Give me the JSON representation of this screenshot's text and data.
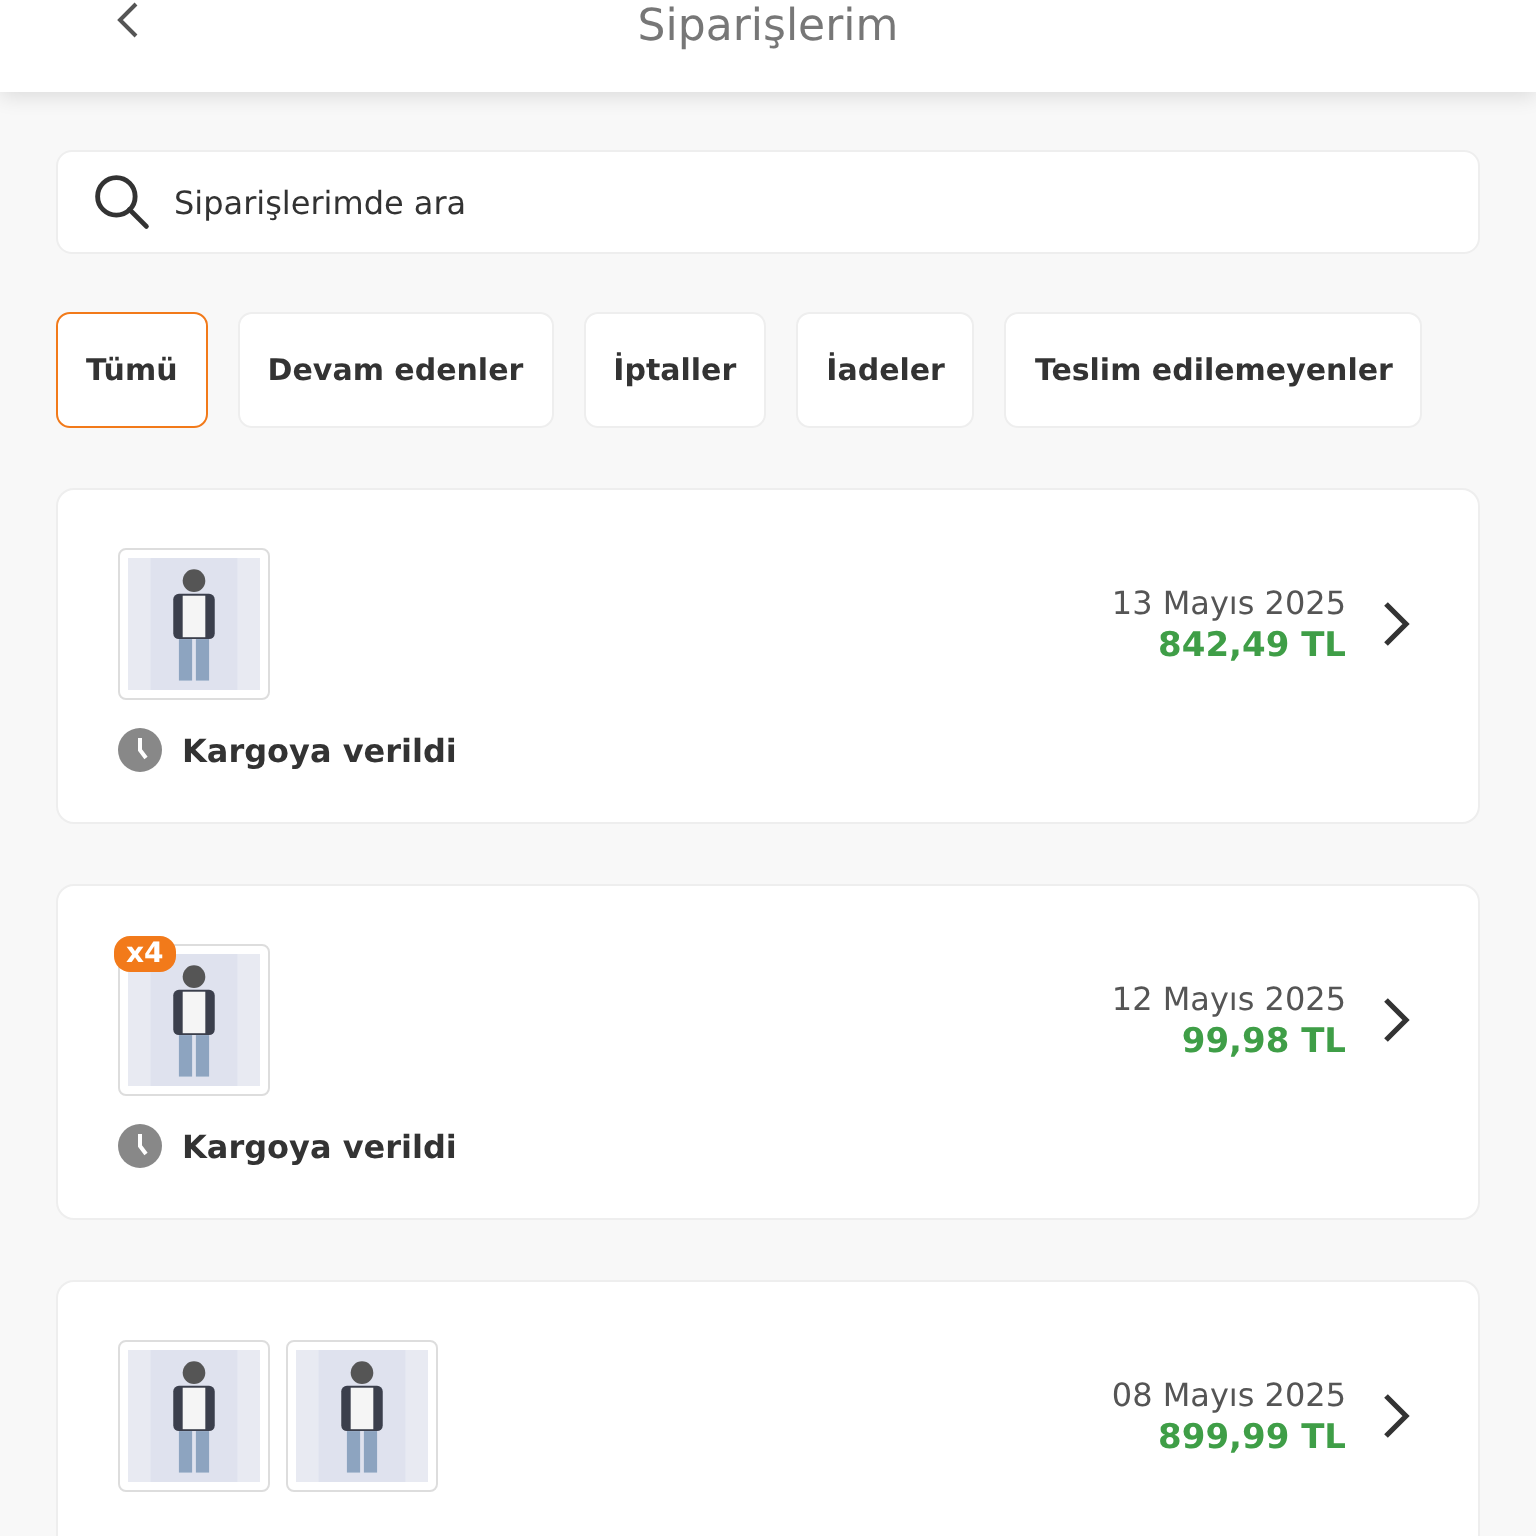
{
  "header": {
    "title": "Siparişlerim"
  },
  "search": {
    "placeholder": "Siparişlerimde ara"
  },
  "filters": [
    {
      "label": "Tümü",
      "selected": true
    },
    {
      "label": "Devam edenler",
      "selected": false
    },
    {
      "label": "İptaller",
      "selected": false
    },
    {
      "label": "İadeler",
      "selected": false
    },
    {
      "label": "Teslim edilemeyenler",
      "selected": false
    }
  ],
  "orders": [
    {
      "date": "13 Mayıs 2025",
      "price": "842,49 TL",
      "status": "Kargoya verildi"
    },
    {
      "images": [
        {
          "kind": "picture",
          "badge": "x4"
        }
      ],
      "date": "12 Mayıs 2025",
      "price": "99,98 TL",
      "status": "Kargoya verildi"
    },
    {
      "date": "08 Mayıs 2025",
      "price": "899,99 TL"
    }
  ]
}
